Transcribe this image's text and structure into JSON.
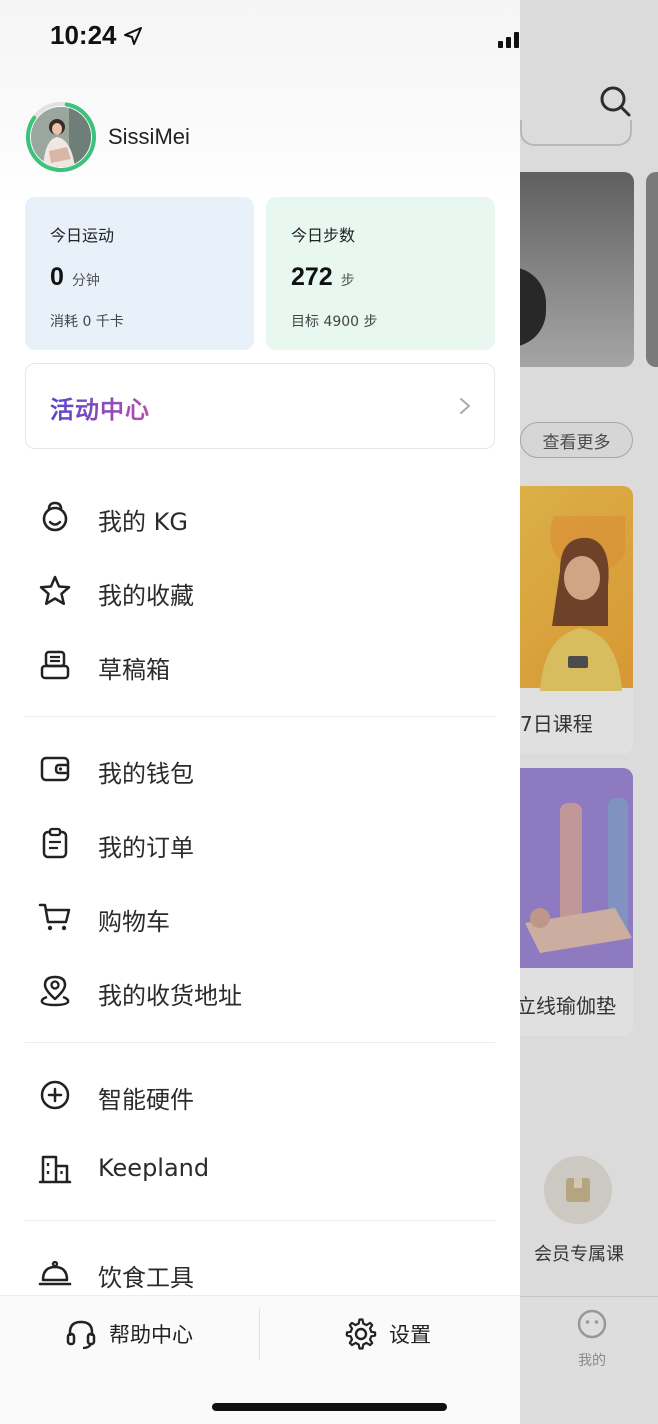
{
  "status_bar": {
    "time": "10:24"
  },
  "profile": {
    "username": "SissiMei"
  },
  "stats": {
    "sport": {
      "title": "今日运动",
      "value": "0",
      "unit": "分钟",
      "sub": "消耗 0 千卡"
    },
    "steps": {
      "title": "今日步数",
      "value": "272",
      "unit": "步",
      "sub": "目标 4900 步"
    }
  },
  "activity": {
    "title": "活动中心"
  },
  "menu": {
    "group1": [
      {
        "label": "我的 KG",
        "icon": "kettlebell-icon"
      },
      {
        "label": "我的收藏",
        "icon": "star-icon"
      },
      {
        "label": "草稿箱",
        "icon": "draft-box-icon"
      }
    ],
    "group2": [
      {
        "label": "我的钱包",
        "icon": "wallet-icon"
      },
      {
        "label": "我的订单",
        "icon": "clipboard-icon"
      },
      {
        "label": "购物车",
        "icon": "cart-icon"
      },
      {
        "label": "我的收货地址",
        "icon": "location-pin-icon"
      }
    ],
    "group3": [
      {
        "label": "智能硬件",
        "icon": "plus-circle-icon"
      },
      {
        "label": "Keepland",
        "icon": "building-icon"
      }
    ],
    "group4": [
      {
        "label": "饮食工具",
        "icon": "food-cloche-icon"
      }
    ]
  },
  "bottom": {
    "help_label": "帮助中心",
    "settings_label": "设置"
  },
  "background": {
    "more_label": "查看更多",
    "course_caption": "7日课程",
    "mat_caption": "立线瑜伽垫",
    "vip_label": "会员专属课",
    "tab_me_label": "我的"
  },
  "colors": {
    "sport_card_bg": "#e8f0fa",
    "steps_card_bg": "#e8f7f0",
    "activity_gradient_start": "#5a47c9",
    "activity_gradient_end": "#b44fb0",
    "avatar_ring": "#3cc27a"
  }
}
